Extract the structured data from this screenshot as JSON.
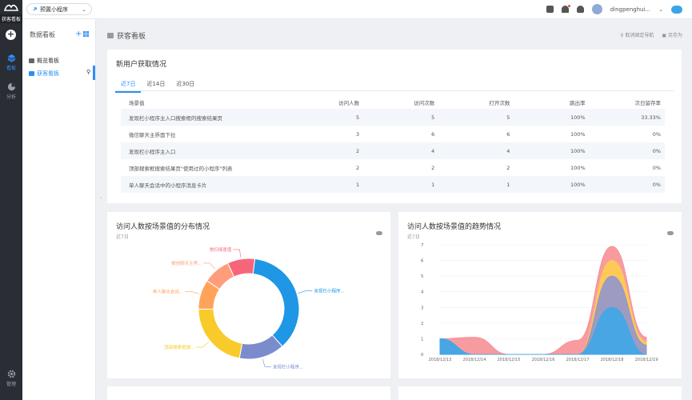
{
  "rail": {
    "logo_tooltip": "获客看板",
    "add": "+",
    "nav": [
      {
        "label": "看板",
        "icon": "layers-icon"
      },
      {
        "label": "分析",
        "icon": "pie-icon"
      },
      {
        "label": "管理",
        "icon": "gear-icon"
      }
    ]
  },
  "header": {
    "app_selector": "预置小程序",
    "username": "dingpenghui...",
    "colors": {
      "accent": "#2a8ff7"
    }
  },
  "sidebar": {
    "title": "数据看板",
    "items": [
      {
        "label": "概览看板"
      },
      {
        "label": "获客看板"
      }
    ]
  },
  "page": {
    "title": "获客看板",
    "actions": [
      "取消固定导航",
      "另存为"
    ]
  },
  "new_users": {
    "title": "新用户获取情况",
    "tabs": [
      "近7日",
      "近14日",
      "近30日"
    ],
    "columns": [
      "场景值",
      "访问人数",
      "访问次数",
      "打开次数",
      "跳出率",
      "次日留存率"
    ],
    "rows": [
      [
        "发现栏小程序主入口搜索框的搜索结果页",
        "5",
        "5",
        "5",
        "100%",
        "33.33%"
      ],
      [
        "微信聊天主界面下拉",
        "3",
        "6",
        "6",
        "100%",
        "0%"
      ],
      [
        "发现栏小程序主入口",
        "2",
        "4",
        "4",
        "100%",
        "0%"
      ],
      [
        "顶部搜索框搜索结果页\"使用过的小程序\"列表",
        "2",
        "2",
        "2",
        "100%",
        "0%"
      ],
      [
        "单人聊天会话中的小程序消息卡片",
        "1",
        "1",
        "1",
        "100%",
        "0%"
      ]
    ]
  },
  "distribution": {
    "title": "访问人数按场景值的分布情况",
    "subtitle": "近7日",
    "labels": [
      "发现栏小程序...",
      "发现栏小程序...",
      "顶部搜索框搜...",
      "单人聊天会话...",
      "微信聊天主界...",
      "常扫场景值"
    ]
  },
  "trend": {
    "title": "访问人数按场景值的趋势情况",
    "subtitle": "近7日"
  },
  "chart_data": [
    {
      "type": "pie",
      "categories": [
        "发现栏小程序...",
        "发现栏小程序...",
        "顶部搜索框搜...",
        "单人聊天会话...",
        "微信聊天主界...",
        "常扫场景值"
      ],
      "values": [
        5,
        2,
        3,
        1.3,
        1.2,
        1.2
      ],
      "colors": [
        "#1f96e6",
        "#7b8ccd",
        "#f9cb2a",
        "#ffa35a",
        "#ff9d7a",
        "#f7657a"
      ]
    },
    {
      "type": "area",
      "x": [
        "2018/12/13",
        "2018/12/14",
        "2018/12/15",
        "2018/12/16",
        "2018/12/17",
        "2018/12/18",
        "2018/12/19"
      ],
      "ylim": [
        0,
        7
      ],
      "yticks": [
        0,
        1,
        2,
        3,
        4,
        5,
        6,
        7
      ],
      "series": [
        {
          "values": [
            1,
            0,
            0,
            0,
            0,
            3,
            0
          ],
          "color": "#3aa8ea"
        },
        {
          "values": [
            0,
            0,
            0,
            0,
            0,
            2,
            0.6
          ],
          "color": "#8c93d3"
        },
        {
          "values": [
            0,
            0,
            0,
            0,
            0,
            1,
            0.2
          ],
          "color": "#ffd14a"
        },
        {
          "values": [
            0,
            1.1,
            0,
            0,
            0.9,
            0.9,
            0.3
          ],
          "color": "#f78a8f"
        }
      ]
    }
  ]
}
